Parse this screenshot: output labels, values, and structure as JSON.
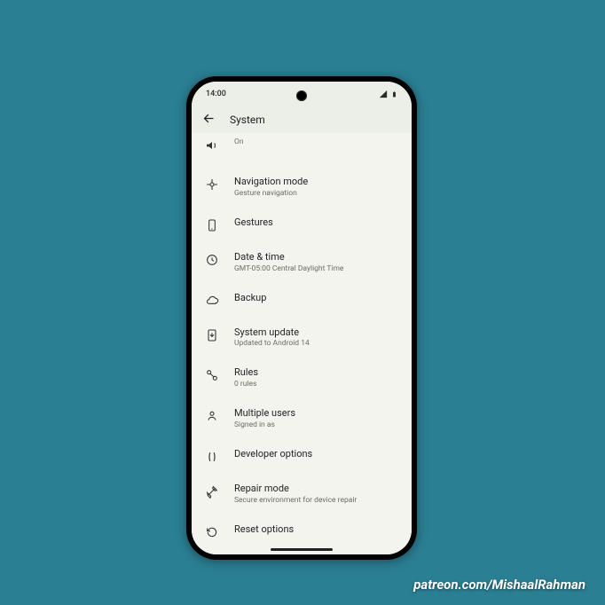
{
  "status": {
    "time": "14:00"
  },
  "header": {
    "title": "System"
  },
  "partial": {
    "sub": "On"
  },
  "items": [
    {
      "title": "Navigation mode",
      "sub": "Gesture navigation"
    },
    {
      "title": "Gestures",
      "sub": ""
    },
    {
      "title": "Date & time",
      "sub": "GMT-05:00 Central Daylight Time"
    },
    {
      "title": "Backup",
      "sub": ""
    },
    {
      "title": "System update",
      "sub": "Updated to Android 14"
    },
    {
      "title": "Rules",
      "sub": "0 rules"
    },
    {
      "title": "Multiple users",
      "sub": "Signed in as"
    },
    {
      "title": "Developer options",
      "sub": ""
    },
    {
      "title": "Repair mode",
      "sub": "Secure environment for device repair"
    },
    {
      "title": "Reset options",
      "sub": ""
    }
  ],
  "credit": "patreon.com/MishaalRahman"
}
